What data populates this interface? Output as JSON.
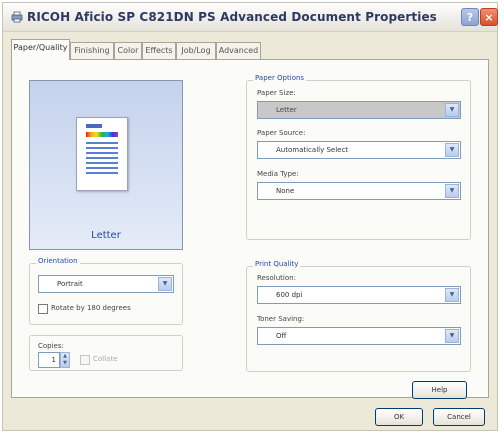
{
  "window": {
    "title": "RICOH Aficio SP C821DN PS Advanced Document Properties",
    "help_button": "?",
    "close_button": "×"
  },
  "tabs": [
    {
      "label": "Paper/Quality",
      "active": true
    },
    {
      "label": "Finishing",
      "active": false
    },
    {
      "label": "Color",
      "active": false
    },
    {
      "label": "Effects",
      "active": false
    },
    {
      "label": "Job/Log",
      "active": false
    },
    {
      "label": "Advanced",
      "active": false
    }
  ],
  "preview": {
    "caption": "Letter",
    "page_logo_text": "RICOH"
  },
  "orientation": {
    "label": "Orientation",
    "value": "Portrait",
    "rotate_label": "Rotate by 180 degrees",
    "rotate_checked": false
  },
  "copies": {
    "label": "Copies:",
    "value": "1",
    "collate_label": "Collate",
    "collate_checked": false,
    "collate_enabled": false
  },
  "paper_options": {
    "label": "Paper Options",
    "size_label": "Paper Size:",
    "size_value": "Letter",
    "source_label": "Paper Source:",
    "source_value": "Automatically Select",
    "media_label": "Media Type:",
    "media_value": "None"
  },
  "print_quality": {
    "label": "Print Quality",
    "resolution_label": "Resolution:",
    "resolution_value": "600 dpi",
    "toner_label": "Toner Saving:",
    "toner_value": "Off"
  },
  "buttons": {
    "help": "Help",
    "ok": "OK",
    "cancel": "Cancel"
  },
  "colors": {
    "title_text": "#2d3a66",
    "group_label": "#2448b4",
    "preview_bg": "#c4d2ec",
    "selected_field": "#c8c8c8"
  }
}
